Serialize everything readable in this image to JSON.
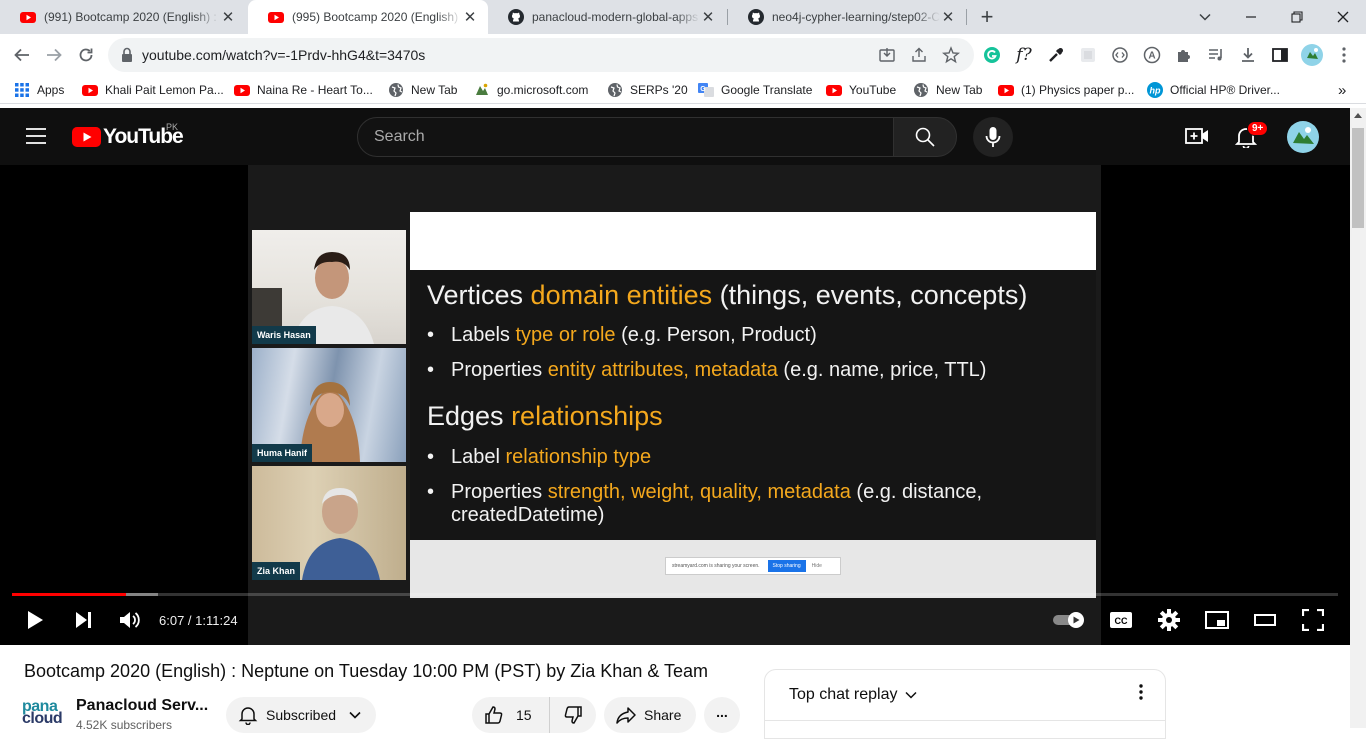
{
  "browser": {
    "tabs": [
      {
        "title": "(991) Bootcamp 2020 (English) :",
        "favicon": "youtube-icon",
        "active": false
      },
      {
        "title": "(995) Bootcamp 2020 (English) :",
        "favicon": "youtube-icon",
        "active": true
      },
      {
        "title": "panacloud-modern-global-apps",
        "favicon": "github-icon",
        "active": false
      },
      {
        "title": "neo4j-cypher-learning/step02-C",
        "favicon": "github-icon",
        "active": false
      }
    ],
    "new_tab_symbol": "+",
    "url": "youtube.com/watch?v=-1Prdv-hhG4&t=3470s",
    "bookmarks": [
      {
        "label": "Apps",
        "icon": "apps-grid-icon"
      },
      {
        "label": "Khali Pait Lemon Pa...",
        "icon": "youtube-icon"
      },
      {
        "label": "Naina Re - Heart To...",
        "icon": "youtube-icon"
      },
      {
        "label": "New Tab",
        "icon": "globe-icon"
      },
      {
        "label": "go.microsoft.com",
        "icon": "page-icon"
      },
      {
        "label": "SERPs '20",
        "icon": "globe-icon"
      },
      {
        "label": "Google Translate",
        "icon": "translate-icon"
      },
      {
        "label": "YouTube",
        "icon": "youtube-icon"
      },
      {
        "label": "New Tab",
        "icon": "globe-icon"
      },
      {
        "label": "(1) Physics paper p...",
        "icon": "youtube-icon"
      },
      {
        "label": "Official HP® Driver...",
        "icon": "hp-icon"
      }
    ],
    "bookmarks_overflow": "»"
  },
  "youtube": {
    "logo_text": "YouTube",
    "country_code": "PK",
    "search_placeholder": "Search",
    "notification_badge": "9+",
    "player": {
      "participants": [
        {
          "name": "Waris Hasan"
        },
        {
          "name": "Huma Hanif"
        },
        {
          "name": "Zia Khan"
        }
      ],
      "slide": {
        "line1": {
          "a": "Vertices ",
          "b": "domain entities",
          "c": " (things, events, concepts)"
        },
        "line2": {
          "a": "Labels ",
          "b": "type or role",
          "c": " (e.g. Person, Product)"
        },
        "line3": {
          "a": "Properties ",
          "b": "entity attributes, metadata",
          "c": " (e.g. name, price, TTL)"
        },
        "line4": {
          "a": "Edges ",
          "b": "relationships"
        },
        "line5": {
          "a": "Label ",
          "b": "relationship type"
        },
        "line6": {
          "a": "Properties ",
          "b": "strength, weight, quality, metadata",
          "c": " (e.g. distance,"
        },
        "line7": {
          "a": "createdDatetime)"
        },
        "share_bar": {
          "text": "streamyard.com is sharing your screen.",
          "stop": "Stop sharing",
          "hide": "Hide"
        }
      },
      "time": "6:07 / 1:11:24",
      "progress": {
        "played": 0.0859,
        "buffered": 0.1101
      },
      "accent": "#ff0000"
    },
    "video_title": "Bootcamp 2020 (English) : Neptune on Tuesday 10:00 PM (PST) by Zia Khan & Team",
    "channel": {
      "name": "Panacloud Serv...",
      "subscribers": "4.52K subscribers",
      "logo_text_1": "pana",
      "logo_text_2": "cloud"
    },
    "subscribe_label": "Subscribed",
    "likes": "15",
    "share_label": "Share",
    "more_label": "...",
    "chat_title": "Top chat replay"
  }
}
